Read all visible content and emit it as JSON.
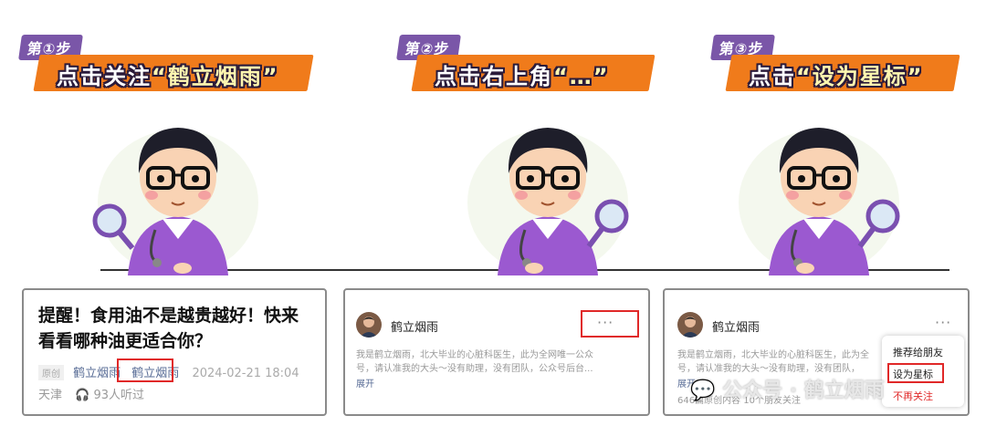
{
  "steps": [
    {
      "badge": "第①步",
      "banner_prefix": "点击关注",
      "banner_quote": "“鹤立烟雨”"
    },
    {
      "badge": "第②步",
      "banner_prefix": "点击右上角",
      "banner_quote": "“…”"
    },
    {
      "badge": "第③步",
      "banner_prefix": "点击",
      "banner_quote": "“设为星标”"
    }
  ],
  "card1": {
    "title": "提醒！食用油不是越贵越好！快来看看哪种油更适合你？",
    "tag": "原创",
    "author1": "鹤立烟雨",
    "author2": "鹤立烟雨",
    "date": "2024-02-21 18:04",
    "location": "天津",
    "listen": "93人听过"
  },
  "card2": {
    "account": "鹤立烟雨",
    "dots": "···",
    "desc_line1": "我是鹤立烟雨，北大毕业的心脏科医生，此为全网唯一公众",
    "desc_line2": "号，请认准我的大头～没有助理，没有团队，公众号后台...",
    "expand": "展开"
  },
  "card3": {
    "account": "鹤立烟雨",
    "dots": "···",
    "desc_line1": "我是鹤立烟雨，北大毕业的心脏科医生，此为全",
    "desc_line2": "号，请认准我的大头～没有助理，没有团队，",
    "expand": "展开",
    "stats": "646篇原创内容  10个朋友关注",
    "menu_recommend": "推荐给朋友",
    "menu_star": "设为星标",
    "menu_unfollow": "不再关注"
  },
  "watermark": "公众号 · 鹤立烟雨",
  "colors": {
    "accent_orange": "#f07b1b",
    "badge_purple": "#7a56a8",
    "highlight_red": "#e02828",
    "link_blue": "#576b95"
  }
}
